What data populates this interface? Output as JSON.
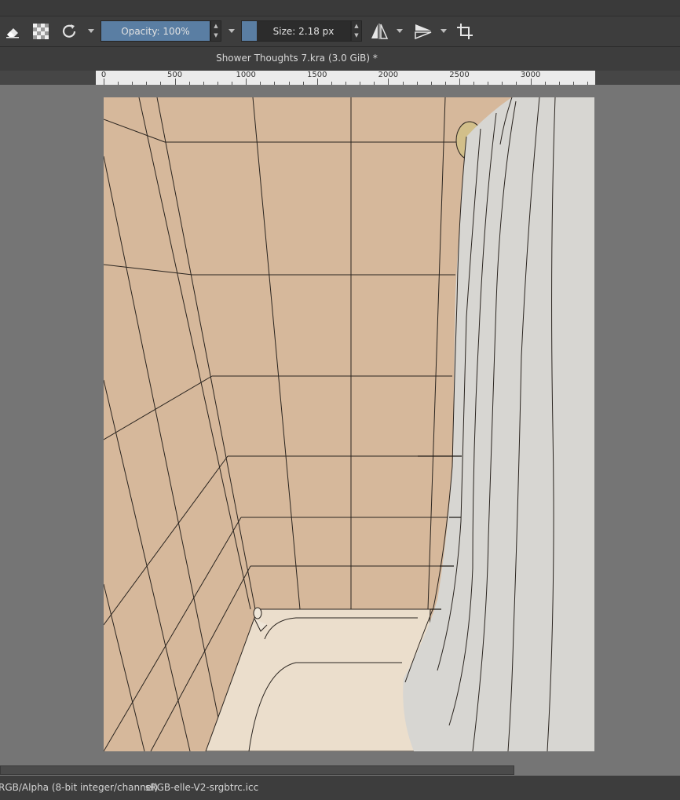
{
  "toolbar": {
    "opacity": {
      "label": "Opacity: 100%",
      "fraction": 1.0
    },
    "size": {
      "label": "Size: 2.18 px"
    },
    "icons": [
      "eraser-icon",
      "transparency-icon",
      "reset-icon",
      "mirror-horizontal-icon",
      "mirror-vertical-icon",
      "crop-icon"
    ]
  },
  "document": {
    "title": "Shower Thoughts 7.kra (3.0 GiB) *"
  },
  "ruler": {
    "labels": [
      "0",
      "500",
      "1000",
      "1500",
      "2000",
      "2500",
      "3000"
    ]
  },
  "status": {
    "color_space": "RGB/Alpha (8-bit integer/channel)",
    "profile": "sRGB-elle-V2-srgbtrc.icc"
  },
  "colors": {
    "tile": "#d6b89b",
    "tub": "#ebdecc",
    "curtain": "#d7d6d2",
    "slider_fill": "#5a7ea3"
  }
}
